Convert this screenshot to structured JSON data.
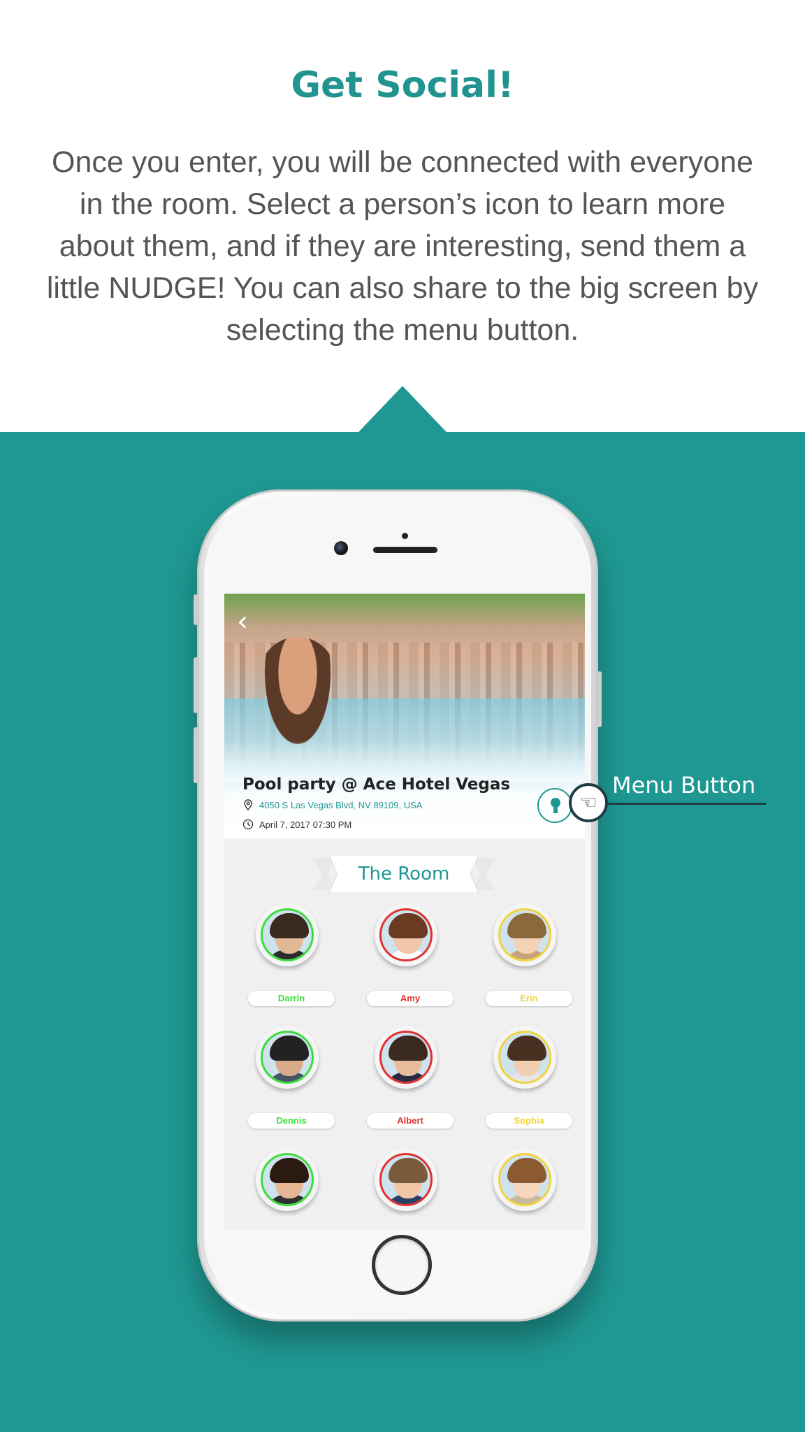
{
  "headline": "Get Social!",
  "intro": "Once you enter, you will be connected with everyone in the room.  Select a person’s icon to learn more about them, and if they are interesting, send them a little NUDGE!  You can also share to the big screen by selecting the menu button.",
  "colors": {
    "teal": "#1f9792",
    "text_gray": "#555555",
    "callout": "#1d3d44"
  },
  "event": {
    "title": "Pool party @ Ace Hotel Vegas",
    "address": "4050 S Las Vegas Blvd, NV 89109, USA",
    "datetime": "April 7, 2017 07:30 PM",
    "address_icon": "location-pin-icon",
    "time_icon": "clock-icon",
    "back_icon": "chevron-left-icon",
    "menu_icon": "keyhole-icon"
  },
  "room": {
    "title": "The Room",
    "people": [
      {
        "name": "Darrin",
        "status_color": "#3ddc3d"
      },
      {
        "name": "Amy",
        "status_color": "#e0312e"
      },
      {
        "name": "Erin",
        "status_color": "#f1d33a"
      },
      {
        "name": "Dennis",
        "status_color": "#3ddc3d"
      },
      {
        "name": "Albert",
        "status_color": "#e0312e"
      },
      {
        "name": "Sophia",
        "status_color": "#f1d33a"
      },
      {
        "name": "",
        "status_color": "#3ddc3d"
      },
      {
        "name": "",
        "status_color": "#e0312e"
      },
      {
        "name": "",
        "status_color": "#f1d33a"
      }
    ]
  },
  "callout": {
    "label": "Menu Button",
    "icon": "pointing-hand-icon"
  }
}
